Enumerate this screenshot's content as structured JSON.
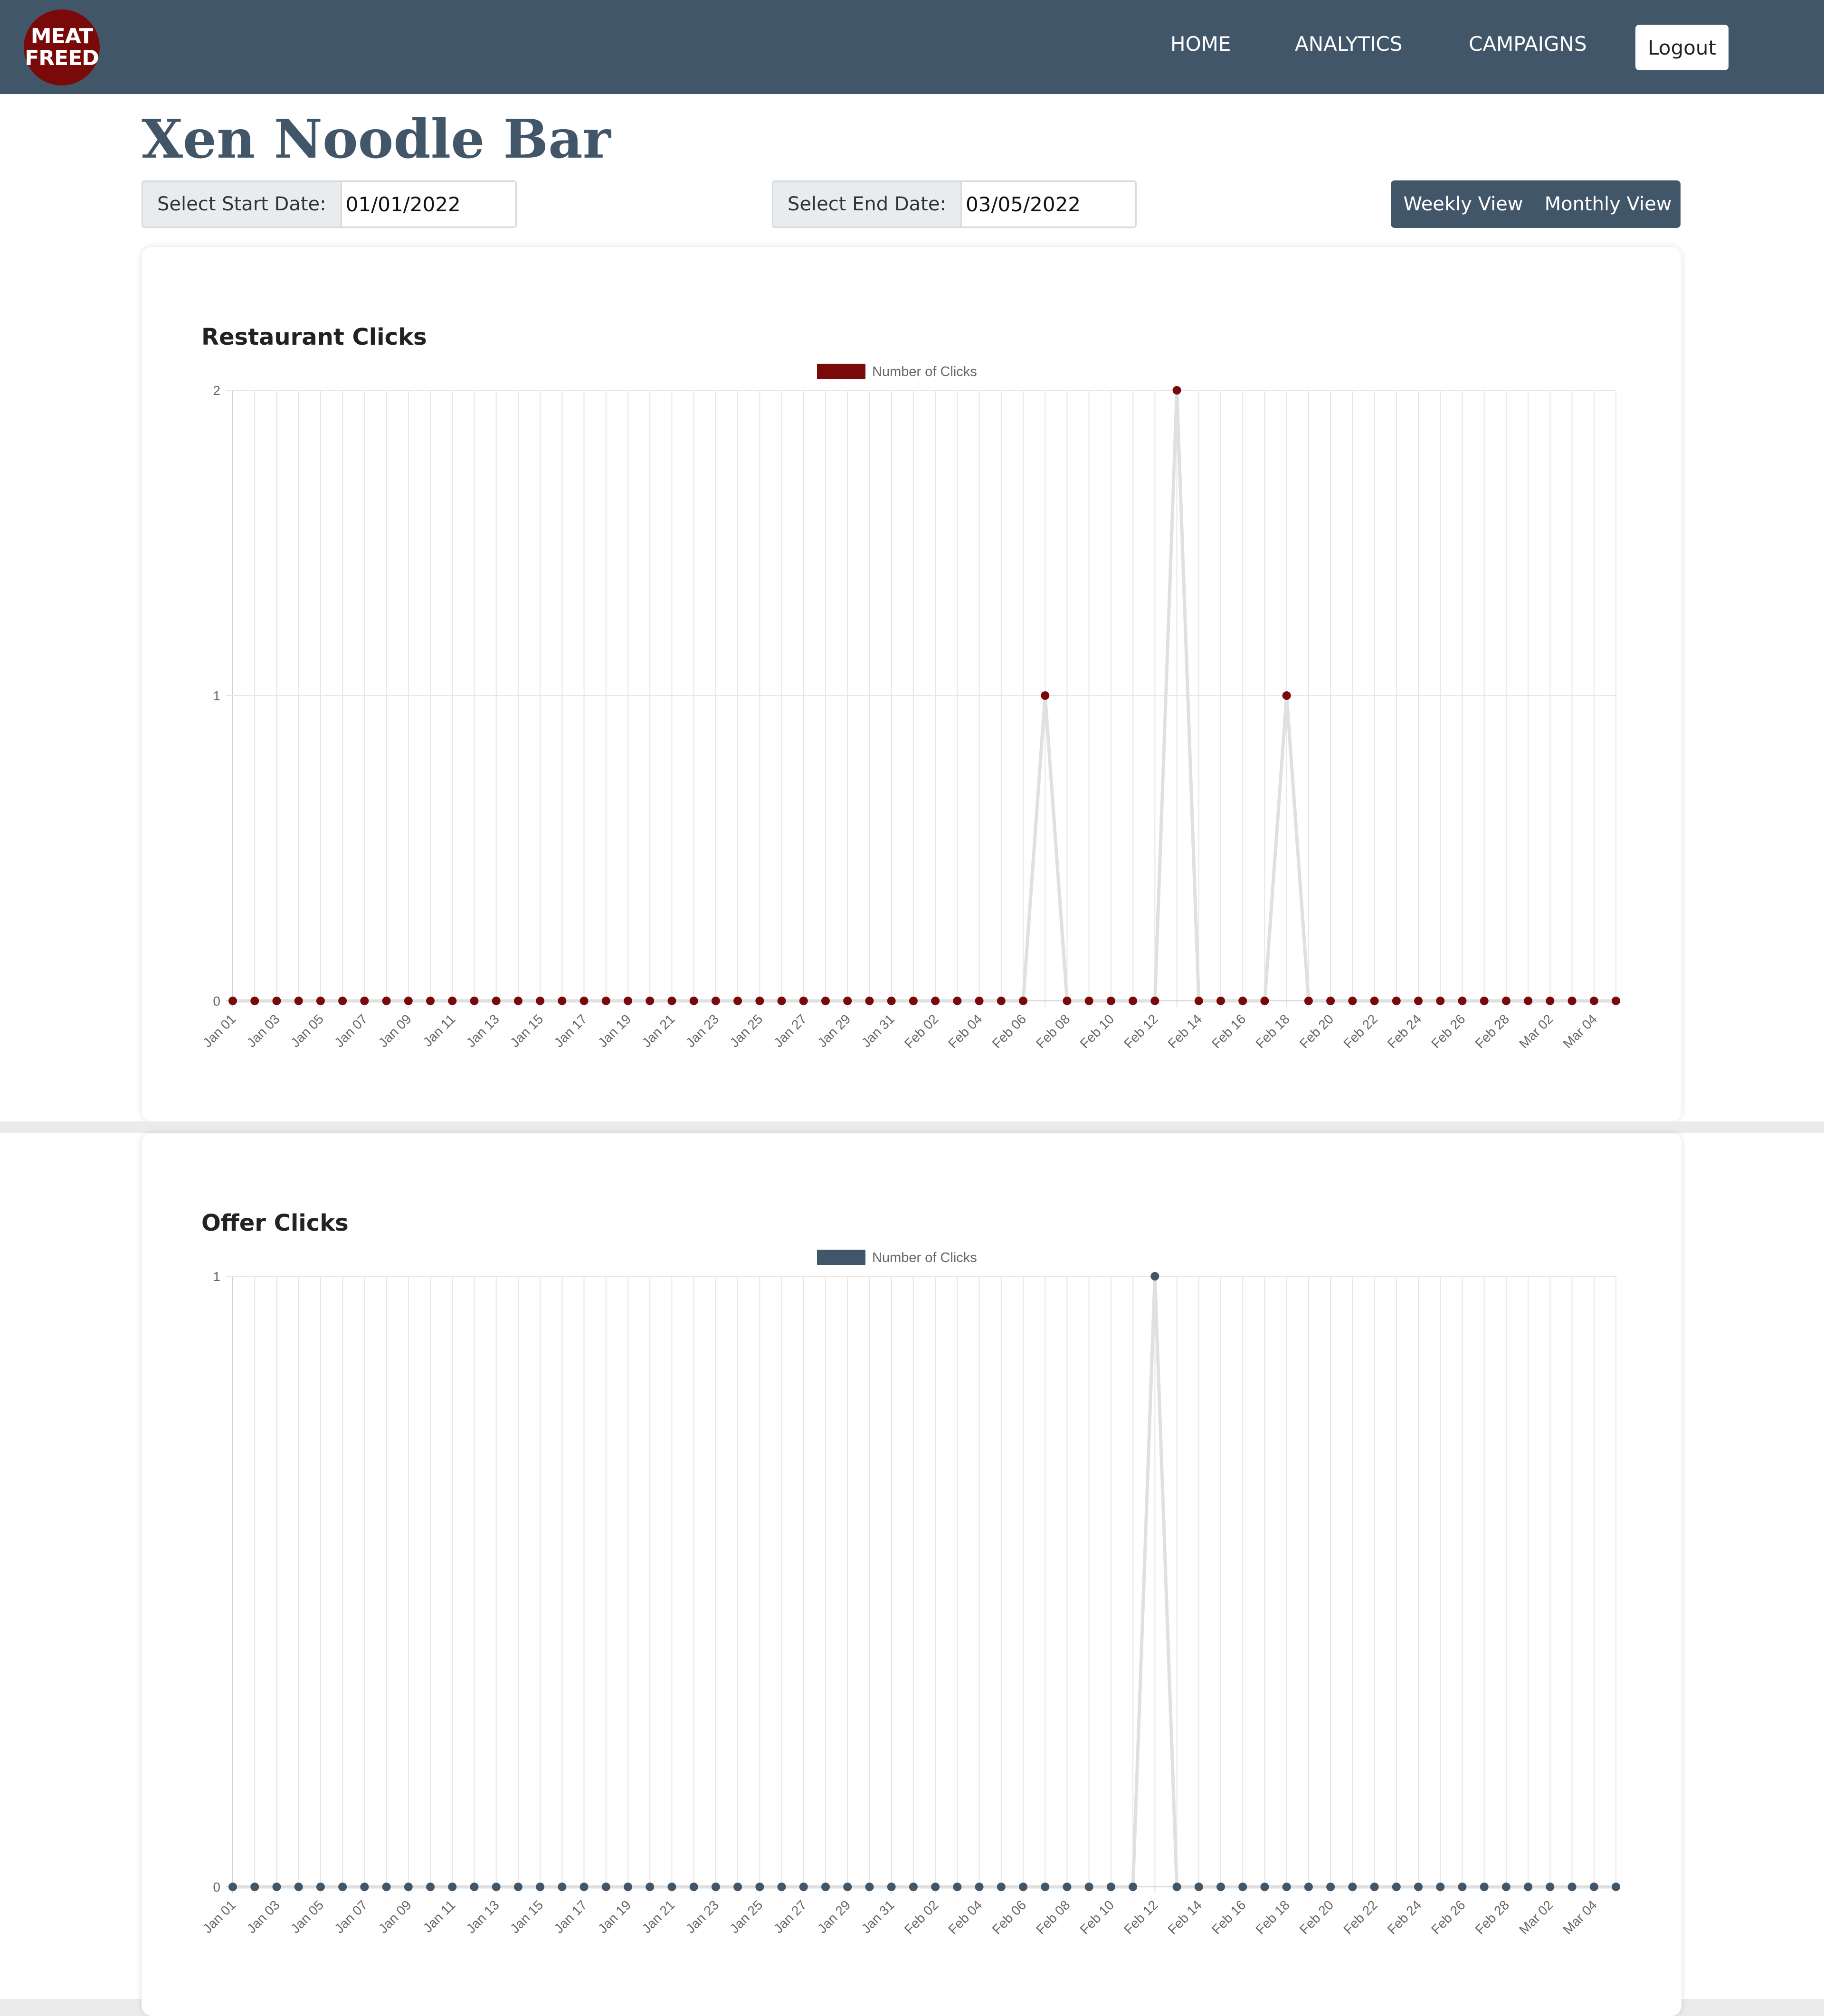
{
  "nav": {
    "logo_line1": "MEAT",
    "logo_line2": "FREED",
    "home": "HOME",
    "analytics": "ANALYTICS",
    "campaigns": "CAMPAIGNS",
    "logout": "Logout"
  },
  "page": {
    "title": "Xen Noodle Bar"
  },
  "filters": {
    "start_label": "Select Start Date:",
    "start_value": "01/01/2022",
    "end_label": "Select End Date:",
    "end_value": "03/05/2022",
    "weekly": "Weekly View",
    "monthly": "Monthly View"
  },
  "colors": {
    "nav_bg": "#425669",
    "restaurant_series": "#7a0a0a",
    "offer_series": "#425669",
    "line": "#e0e0e0",
    "grid": "#e6e6e6"
  },
  "chart_data": [
    {
      "type": "line",
      "title": "Restaurant Clicks",
      "x": [
        "Jan 01",
        "Jan 02",
        "Jan 03",
        "Jan 04",
        "Jan 05",
        "Jan 06",
        "Jan 07",
        "Jan 08",
        "Jan 09",
        "Jan 10",
        "Jan 11",
        "Jan 12",
        "Jan 13",
        "Jan 14",
        "Jan 15",
        "Jan 16",
        "Jan 17",
        "Jan 18",
        "Jan 19",
        "Jan 20",
        "Jan 21",
        "Jan 22",
        "Jan 23",
        "Jan 24",
        "Jan 25",
        "Jan 26",
        "Jan 27",
        "Jan 28",
        "Jan 29",
        "Jan 30",
        "Jan 31",
        "Feb 01",
        "Feb 02",
        "Feb 03",
        "Feb 04",
        "Feb 05",
        "Feb 06",
        "Feb 07",
        "Feb 08",
        "Feb 09",
        "Feb 10",
        "Feb 11",
        "Feb 12",
        "Feb 13",
        "Feb 14",
        "Feb 15",
        "Feb 16",
        "Feb 17",
        "Feb 18",
        "Feb 19",
        "Feb 20",
        "Feb 21",
        "Feb 22",
        "Feb 23",
        "Feb 24",
        "Feb 25",
        "Feb 26",
        "Feb 27",
        "Feb 28",
        "Mar 01",
        "Mar 02",
        "Mar 03",
        "Mar 04",
        "Mar 05"
      ],
      "series": [
        {
          "name": "Number of Clicks",
          "color": "#7a0a0a",
          "values": [
            0,
            0,
            0,
            0,
            0,
            0,
            0,
            0,
            0,
            0,
            0,
            0,
            0,
            0,
            0,
            0,
            0,
            0,
            0,
            0,
            0,
            0,
            0,
            0,
            0,
            0,
            0,
            0,
            0,
            0,
            0,
            0,
            0,
            0,
            0,
            0,
            0,
            1,
            0,
            0,
            0,
            0,
            0,
            2,
            0,
            0,
            0,
            0,
            1,
            0,
            0,
            0,
            0,
            0,
            0,
            0,
            0,
            0,
            0,
            0,
            0,
            0,
            0,
            0
          ]
        }
      ],
      "ylim": [
        0,
        2
      ],
      "yticks": [
        "0",
        "1",
        "2"
      ],
      "grid": true,
      "legend": "top-center"
    },
    {
      "type": "line",
      "title": "Offer Clicks",
      "x": [
        "Jan 01",
        "Jan 02",
        "Jan 03",
        "Jan 04",
        "Jan 05",
        "Jan 06",
        "Jan 07",
        "Jan 08",
        "Jan 09",
        "Jan 10",
        "Jan 11",
        "Jan 12",
        "Jan 13",
        "Jan 14",
        "Jan 15",
        "Jan 16",
        "Jan 17",
        "Jan 18",
        "Jan 19",
        "Jan 20",
        "Jan 21",
        "Jan 22",
        "Jan 23",
        "Jan 24",
        "Jan 25",
        "Jan 26",
        "Jan 27",
        "Jan 28",
        "Jan 29",
        "Jan 30",
        "Jan 31",
        "Feb 01",
        "Feb 02",
        "Feb 03",
        "Feb 04",
        "Feb 05",
        "Feb 06",
        "Feb 07",
        "Feb 08",
        "Feb 09",
        "Feb 10",
        "Feb 11",
        "Feb 12",
        "Feb 13",
        "Feb 14",
        "Feb 15",
        "Feb 16",
        "Feb 17",
        "Feb 18",
        "Feb 19",
        "Feb 20",
        "Feb 21",
        "Feb 22",
        "Feb 23",
        "Feb 24",
        "Feb 25",
        "Feb 26",
        "Feb 27",
        "Feb 28",
        "Mar 01",
        "Mar 02",
        "Mar 03",
        "Mar 04",
        "Mar 05"
      ],
      "series": [
        {
          "name": "Number of Clicks",
          "color": "#425669",
          "values": [
            0,
            0,
            0,
            0,
            0,
            0,
            0,
            0,
            0,
            0,
            0,
            0,
            0,
            0,
            0,
            0,
            0,
            0,
            0,
            0,
            0,
            0,
            0,
            0,
            0,
            0,
            0,
            0,
            0,
            0,
            0,
            0,
            0,
            0,
            0,
            0,
            0,
            0,
            0,
            0,
            0,
            0,
            1,
            0,
            0,
            0,
            0,
            0,
            0,
            0,
            0,
            0,
            0,
            0,
            0,
            0,
            0,
            0,
            0,
            0,
            0,
            0,
            0,
            0
          ]
        }
      ],
      "ylim": [
        0,
        1
      ],
      "yticks": [
        "0",
        "1"
      ],
      "grid": true,
      "legend": "top-center"
    }
  ]
}
